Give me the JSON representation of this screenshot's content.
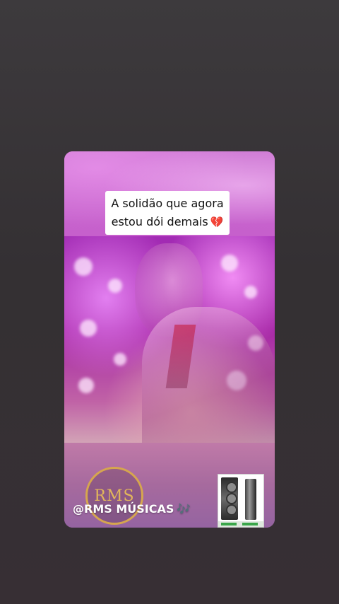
{
  "story": {
    "caption_line1": "A solidão que agora",
    "caption_line2": "estou dói demais",
    "caption_emoji": "💔",
    "logo_text": "RMS",
    "handle": "@RMS MÚSICAS",
    "handle_emoji": "🎶"
  },
  "colors": {
    "background": "#3a3539",
    "card_accent": "#c35fca",
    "logo_gold": "#d6a64e"
  },
  "icons": [
    "broken-heart-icon",
    "music-notes-icon"
  ]
}
